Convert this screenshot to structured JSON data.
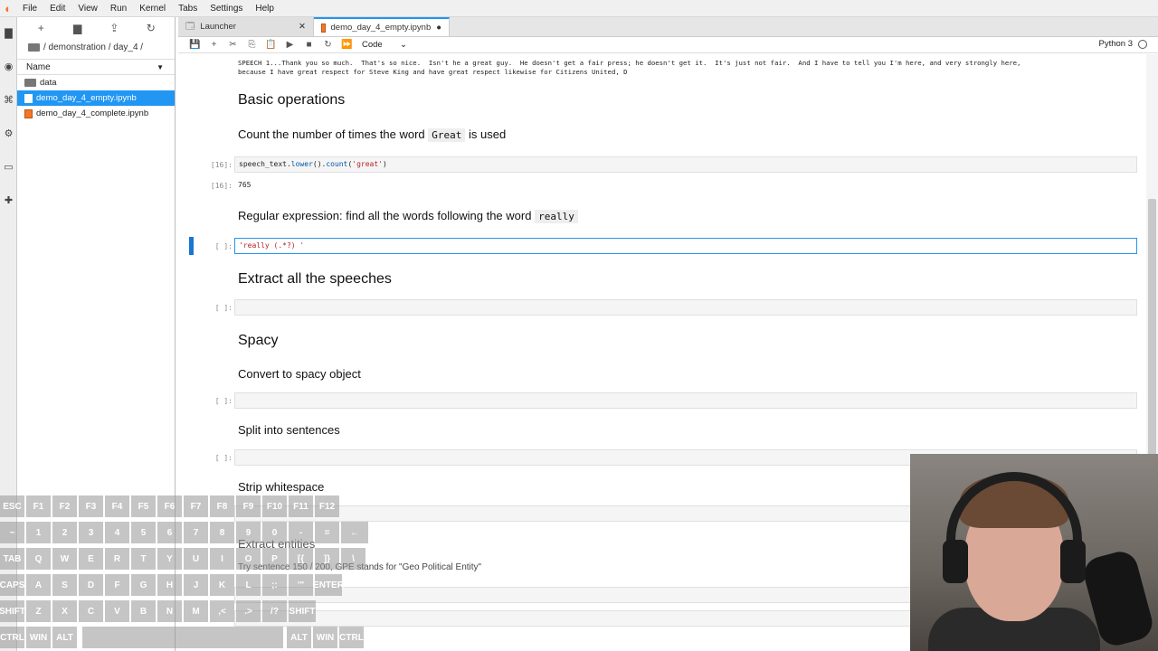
{
  "menubar": {
    "items": [
      "File",
      "Edit",
      "View",
      "Run",
      "Kernel",
      "Tabs",
      "Settings",
      "Help"
    ]
  },
  "filebrowser": {
    "path": "/ demonstration / day_4 /",
    "column_name": "Name",
    "items": [
      {
        "name": "data",
        "type": "folder"
      },
      {
        "name": "demo_day_4_empty.ipynb",
        "type": "notebook",
        "selected": true
      },
      {
        "name": "demo_day_4_complete.ipynb",
        "type": "notebook"
      }
    ]
  },
  "tabs": [
    {
      "label": "Launcher",
      "close": "✕"
    },
    {
      "label": "demo_day_4_empty.ipynb",
      "close": "●"
    }
  ],
  "toolbar": {
    "cell_type": "Code"
  },
  "kernel": {
    "name": "Python 3"
  },
  "notebook": {
    "output_text": "SPEECH 1...Thank you so much.  That's so nice.  Isn't he a great guy.  He doesn't get a fair press; he doesn't get it.  It's just not fair.  And I have to tell you I'm here, and very strongly here,\nbecause I have great respect for Steve King and have great respect likewise for Citizens United, D",
    "h_basic": "Basic operations",
    "count_pre": "Count the number of times the word",
    "count_code": "Great",
    "count_post": "is used",
    "cell16_prompt": "[16]:",
    "cell16_a": "speech_text.",
    "cell16_fn1": "lower",
    "cell16_b": "().",
    "cell16_fn2": "count",
    "cell16_c": "(",
    "cell16_str": "'great'",
    "cell16_d": ")",
    "out16_prompt": "[16]:",
    "out16_value": "765",
    "regex_pre": "Regular expression: find all the words following the word",
    "regex_code": "really",
    "active_prompt": "[ ]:",
    "active_code": "'really (.*?) '",
    "h_extract": "Extract all the speeches",
    "empty_prompt": "[ ]:",
    "h_spacy": "Spacy",
    "convert": "Convert to spacy object",
    "split": "Split into sentences",
    "strip": "Strip whitespace",
    "entities": "Extract entities",
    "entities_note": "Try sentence 150 / 200, GPE stands for \"Geo Political Entity\""
  },
  "keyboard": {
    "rows": [
      [
        "ESC",
        "F1",
        "F2",
        "F3",
        "F4",
        "F5",
        "F6",
        "F7",
        "F8",
        "F9",
        "F10",
        "F11",
        "F12"
      ],
      [
        "~",
        "1",
        "2",
        "3",
        "4",
        "5",
        "6",
        "7",
        "8",
        "9",
        "0",
        "-",
        "=",
        "←"
      ],
      [
        "TAB",
        "Q",
        "W",
        "E",
        "R",
        "T",
        "Y",
        "U",
        "I",
        "O",
        "P",
        "[{",
        "]}",
        "\\"
      ],
      [
        "CAPS",
        "A",
        "S",
        "D",
        "F",
        "G",
        "H",
        "J",
        "K",
        "L",
        ";:",
        "'\"",
        "ENTER"
      ],
      [
        "SHIFT",
        "Z",
        "X",
        "C",
        "V",
        "B",
        "N",
        "M",
        ",<",
        ".>",
        "/?",
        "SHIFT"
      ],
      [
        "CTRL",
        "WIN",
        "ALT",
        "ALT",
        "WIN",
        "CTRL"
      ]
    ]
  }
}
